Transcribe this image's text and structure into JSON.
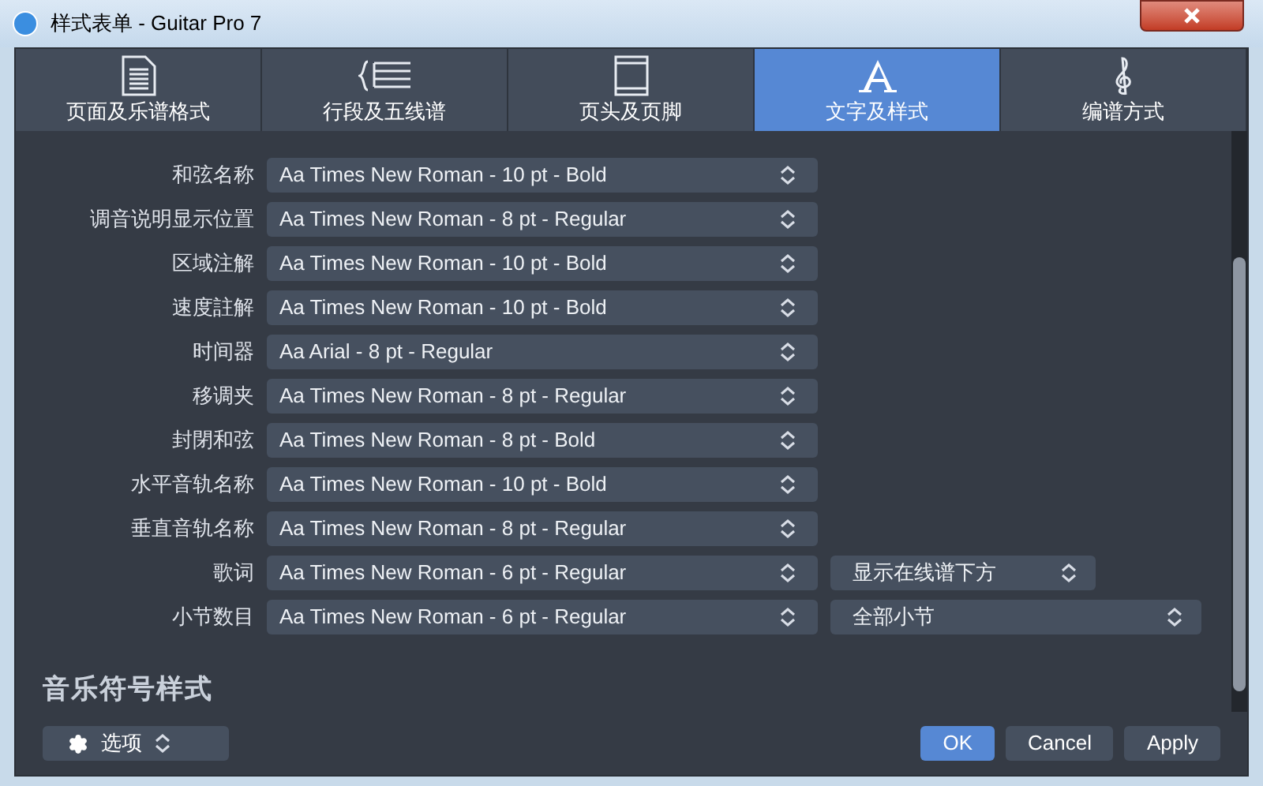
{
  "window": {
    "title": "样式表单 - Guitar Pro 7"
  },
  "tabs": [
    {
      "label": "页面及乐谱格式",
      "selected": false
    },
    {
      "label": "行段及五线谱",
      "selected": false
    },
    {
      "label": "页头及页脚",
      "selected": false
    },
    {
      "label": "文字及样式",
      "selected": true
    },
    {
      "label": "编谱方式",
      "selected": false
    }
  ],
  "rows": [
    {
      "label": "和弦名称",
      "font": "Aa Times New Roman - 10 pt - Bold"
    },
    {
      "label": "调音说明显示位置",
      "font": "Aa Times New Roman - 8 pt - Regular"
    },
    {
      "label": "区域注解",
      "font": "Aa Times New Roman - 10 pt - Bold"
    },
    {
      "label": "速度註解",
      "font": "Aa Times New Roman - 10 pt - Bold"
    },
    {
      "label": "时间器",
      "font": "Aa Arial - 8 pt - Regular"
    },
    {
      "label": "移调夹",
      "font": "Aa Times New Roman - 8 pt - Regular"
    },
    {
      "label": "封閉和弦",
      "font": "Aa Times New Roman - 8 pt - Bold"
    },
    {
      "label": "水平音轨名称",
      "font": "Aa Times New Roman - 10 pt - Bold"
    },
    {
      "label": "垂直音轨名称",
      "font": "Aa Times New Roman - 8 pt - Regular"
    },
    {
      "label": "歌词",
      "font": "Aa Times New Roman - 6 pt - Regular",
      "option": "显示在线谱下方",
      "option_wide": false
    },
    {
      "label": "小节数目",
      "font": "Aa Times New Roman - 6 pt - Regular",
      "option": "全部小节",
      "option_wide": true
    }
  ],
  "section_title": "音乐符号样式",
  "options_button": "选项",
  "buttons": [
    {
      "label": "OK",
      "primary": true
    },
    {
      "label": "Cancel",
      "primary": false
    },
    {
      "label": "Apply",
      "primary": false
    }
  ]
}
